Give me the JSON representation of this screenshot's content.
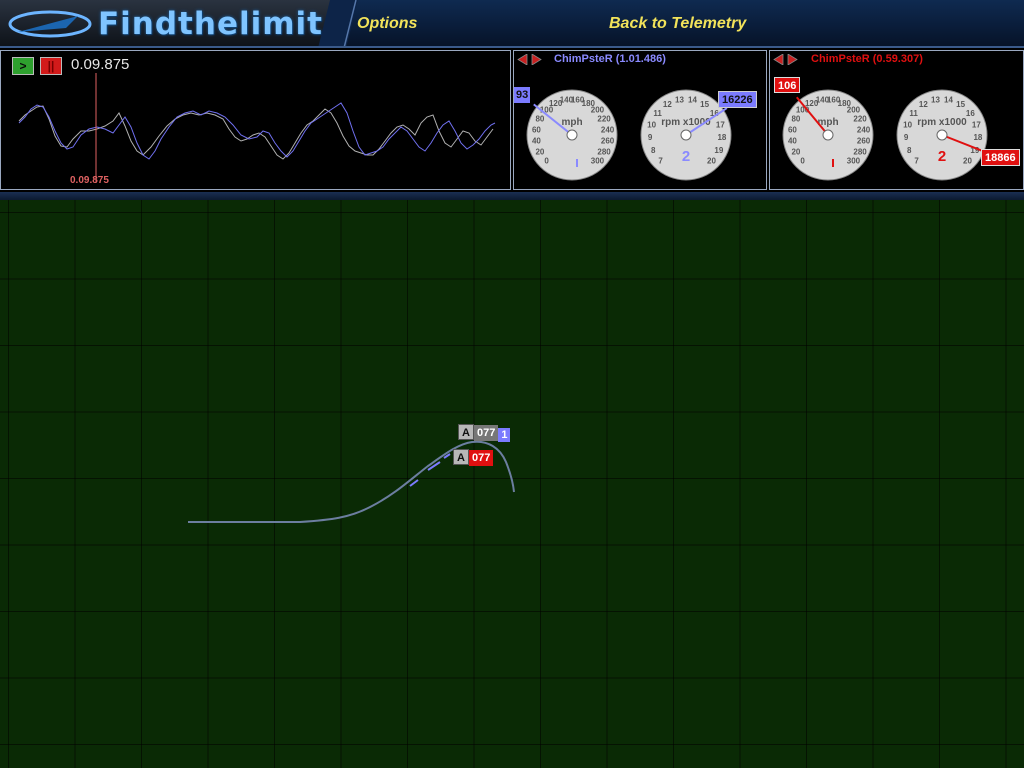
{
  "header": {
    "logo_text": "Findthelimit",
    "nav": [
      {
        "label": "Options"
      },
      {
        "label": "Back to Telemetry"
      }
    ]
  },
  "graph": {
    "time": "0.09.875",
    "cursor_time": "0.09.875",
    "play_icon": ">",
    "stop_icon": "||"
  },
  "drivers": [
    {
      "name": "ChimPsteR (1.01.486)",
      "color": "#8a8aff",
      "speed": "93",
      "rpm": "16226",
      "gear": "2",
      "speed_unit": "mph",
      "rpm_unit": "rpm x1000",
      "speed_ticks": [
        "0",
        "20",
        "40",
        "60",
        "80",
        "100",
        "120",
        "140",
        "160",
        "180",
        "200",
        "220",
        "240",
        "260",
        "280",
        "300"
      ],
      "rpm_ticks": [
        "7",
        "8",
        "9",
        "10",
        "11",
        "12",
        "13",
        "14",
        "15",
        "16",
        "17",
        "18",
        "19",
        "20"
      ]
    },
    {
      "name": "ChimPsteR (0.59.307)",
      "color": "#e01010",
      "speed": "106",
      "rpm": "18866",
      "gear": "2",
      "speed_unit": "mph",
      "rpm_unit": "rpm x1000",
      "speed_ticks": [
        "0",
        "20",
        "40",
        "60",
        "80",
        "100",
        "120",
        "140",
        "160",
        "180",
        "200",
        "220",
        "240",
        "260",
        "280",
        "300"
      ],
      "rpm_ticks": [
        "7",
        "8",
        "9",
        "10",
        "11",
        "12",
        "13",
        "14",
        "15",
        "16",
        "17",
        "18",
        "19",
        "20"
      ]
    }
  ],
  "map": {
    "markers": [
      {
        "letter": "A",
        "value": "077",
        "tag": "1",
        "color": "#777777"
      },
      {
        "letter": "A",
        "value": "077",
        "color": "#e01010"
      }
    ]
  },
  "colors": {
    "trace_a": "#7070f0",
    "trace_b": "#b0b0b0",
    "cursor": "#e06262",
    "accent_yellow": "#f2e35a"
  }
}
